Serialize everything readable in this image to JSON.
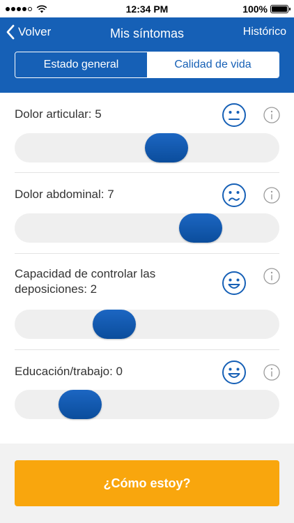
{
  "status_bar": {
    "time": "12:34 PM",
    "battery": "100%"
  },
  "nav": {
    "back_label": "Volver",
    "title": "Mis síntomas",
    "history_label": "Histórico"
  },
  "tabs": [
    {
      "label": "Estado general",
      "active": true
    },
    {
      "label": "Calidad de vida",
      "active": false
    }
  ],
  "items": [
    {
      "label": "Dolor articular: 5",
      "value": 5,
      "face": "neutral-face-icon"
    },
    {
      "label": "Dolor abdominal: 7",
      "value": 7,
      "face": "sad-face-icon"
    },
    {
      "label": "Capacidad de controlar las deposiciones: 2",
      "value": 2,
      "face": "happy-face-icon"
    },
    {
      "label": "Educación/trabajo: 0",
      "value": 0,
      "face": "happy-face-icon"
    }
  ],
  "slider_range": [
    0,
    10
  ],
  "cta": {
    "label": "¿Cómo estoy?"
  },
  "colors": {
    "primary": "#1660b6",
    "accent": "#f9a60d",
    "track": "#efefef"
  }
}
